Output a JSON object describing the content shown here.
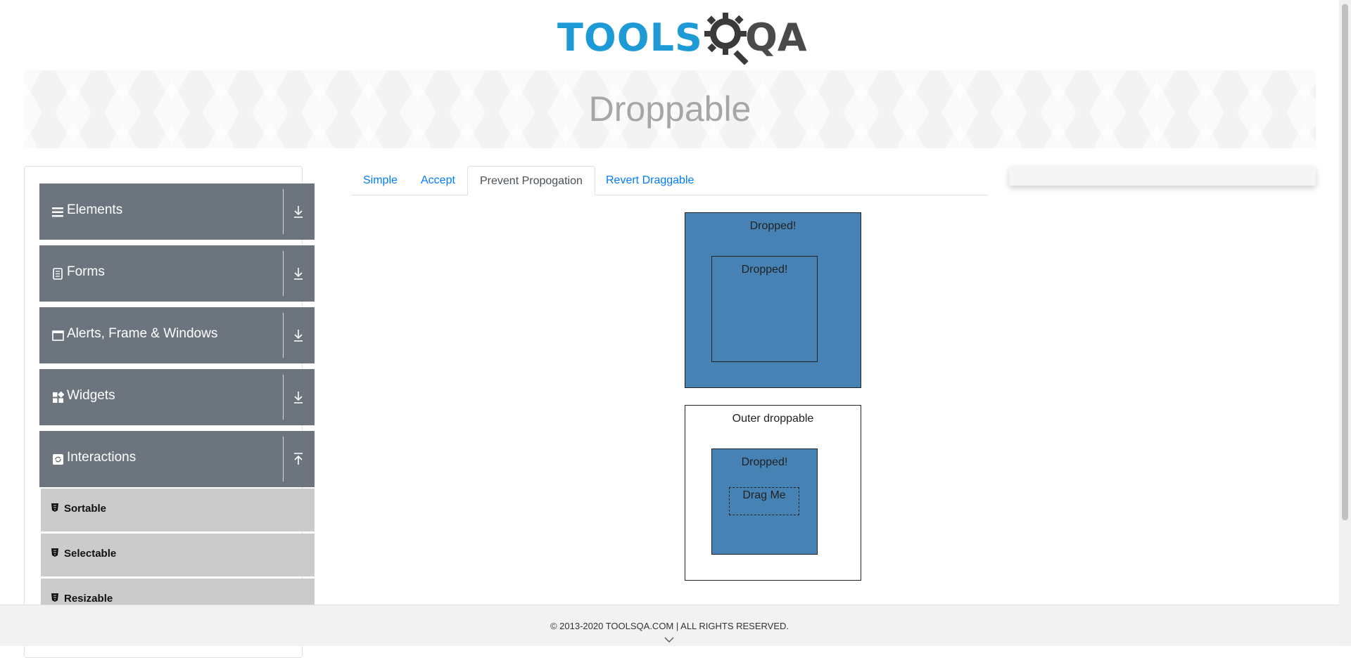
{
  "logo": {
    "tools": "TOOLS",
    "qa": "QA"
  },
  "page_title": "Droppable",
  "sidebar": {
    "groups": [
      {
        "label": "Elements",
        "icon": "menu-icon",
        "arrow": "down"
      },
      {
        "label": "Forms",
        "icon": "document-icon",
        "arrow": "down"
      },
      {
        "label": "Alerts, Frame & Windows",
        "icon": "window-icon",
        "arrow": "down"
      },
      {
        "label": "Widgets",
        "icon": "widgets-icon",
        "arrow": "down"
      },
      {
        "label": "Interactions",
        "icon": "refresh-icon",
        "arrow": "up"
      }
    ],
    "sub_items": [
      {
        "label": "Sortable"
      },
      {
        "label": "Selectable"
      },
      {
        "label": "Resizable"
      }
    ]
  },
  "tabs": [
    {
      "label": "Simple"
    },
    {
      "label": "Accept"
    },
    {
      "label": "Prevent Propogation",
      "active": true
    },
    {
      "label": "Revert Draggable"
    }
  ],
  "content": {
    "box1_outer_label": "Dropped!",
    "box1_inner_label": "Dropped!",
    "box2_outer_label": "Outer droppable",
    "box2_inner_label": "Dropped!",
    "drag_label": "Drag Me",
    "drop_color": "#4682b4"
  },
  "footer": {
    "text": "© 2013-2020 TOOLSQA.COM | ALL RIGHTS RESERVED."
  },
  "colors": {
    "brand_blue": "#1e9bd7",
    "sidebar_group": "#6c757d",
    "sidebar_sub": "#cbcbcb",
    "link": "#007bff"
  }
}
